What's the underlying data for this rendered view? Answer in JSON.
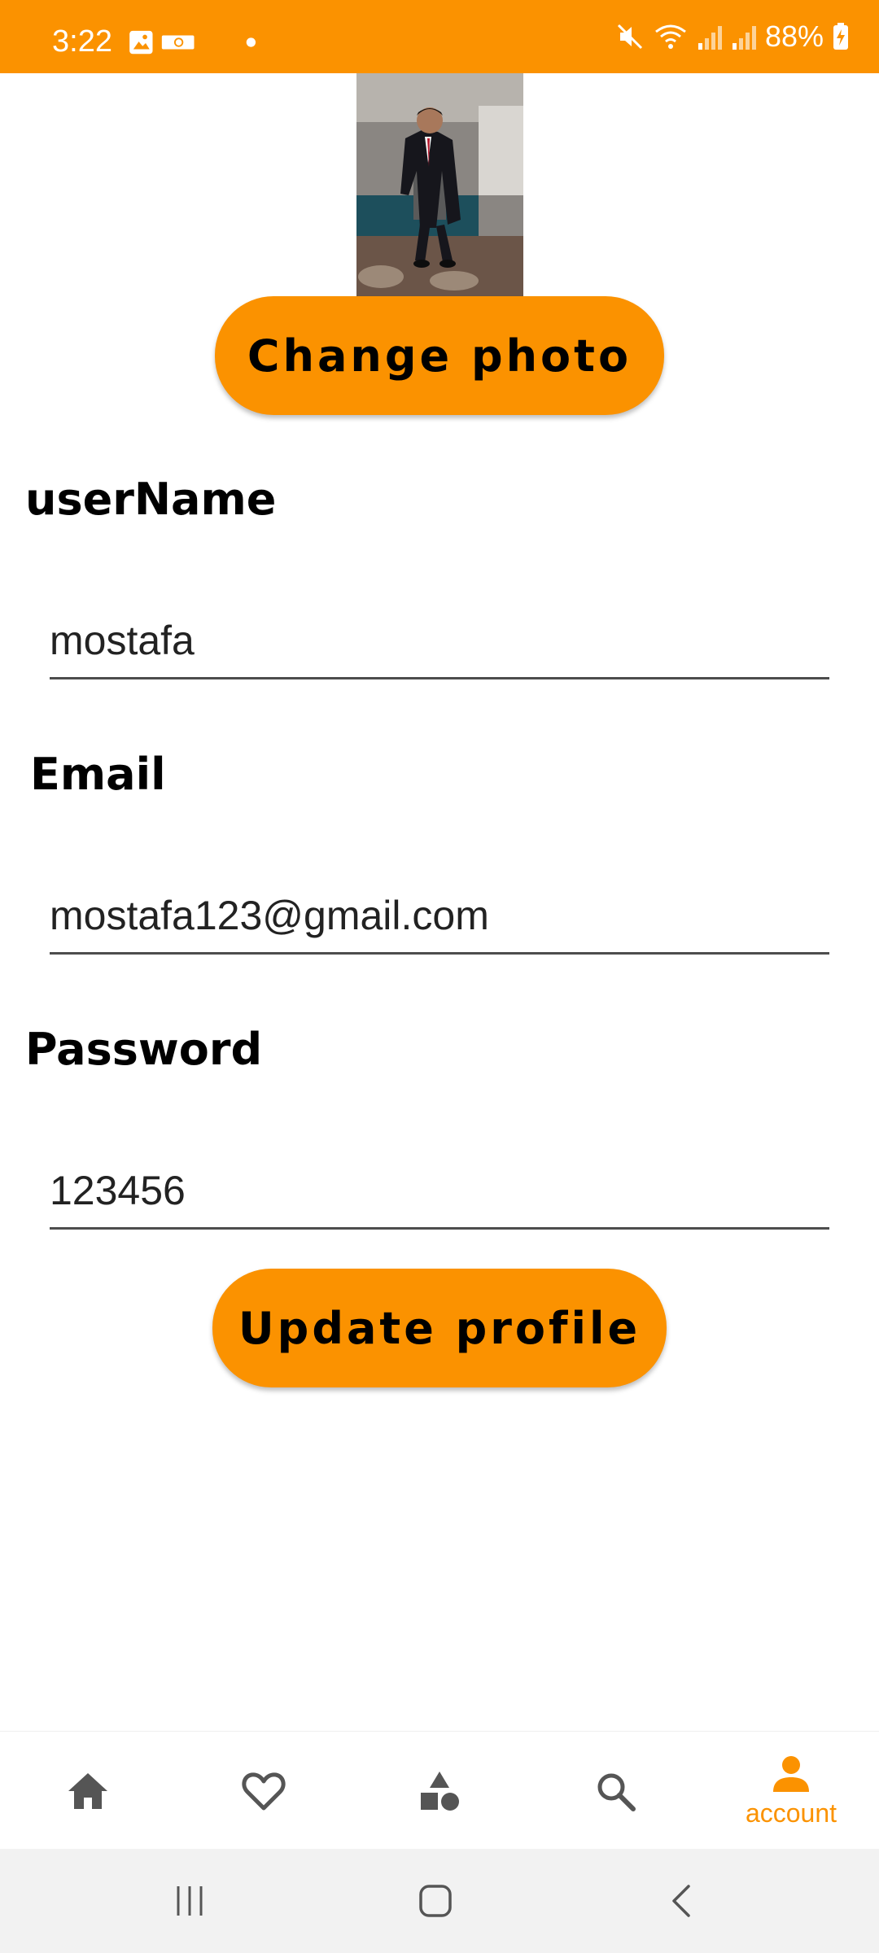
{
  "status_bar": {
    "time": "3:22",
    "battery": "88%",
    "color": "#fb9200"
  },
  "profile": {
    "change_photo_label": "Change photo",
    "update_profile_label": "Update profile"
  },
  "fields": {
    "username": {
      "label": "userName",
      "value": "mostafa"
    },
    "email": {
      "label": "Email",
      "value": "mostafa123@gmail.com"
    },
    "password": {
      "label": "Password",
      "value": "123456"
    }
  },
  "bottom_nav": {
    "items": [
      {
        "icon": "home-icon",
        "label": ""
      },
      {
        "icon": "heart-icon",
        "label": ""
      },
      {
        "icon": "categories-icon",
        "label": ""
      },
      {
        "icon": "search-icon",
        "label": ""
      },
      {
        "icon": "account-icon",
        "label": "account",
        "active": true
      }
    ],
    "active_color": "#fb9200",
    "inactive_color": "#555555"
  },
  "system_nav": {
    "icons": [
      "recents-icon",
      "home-button-icon",
      "back-icon"
    ]
  }
}
